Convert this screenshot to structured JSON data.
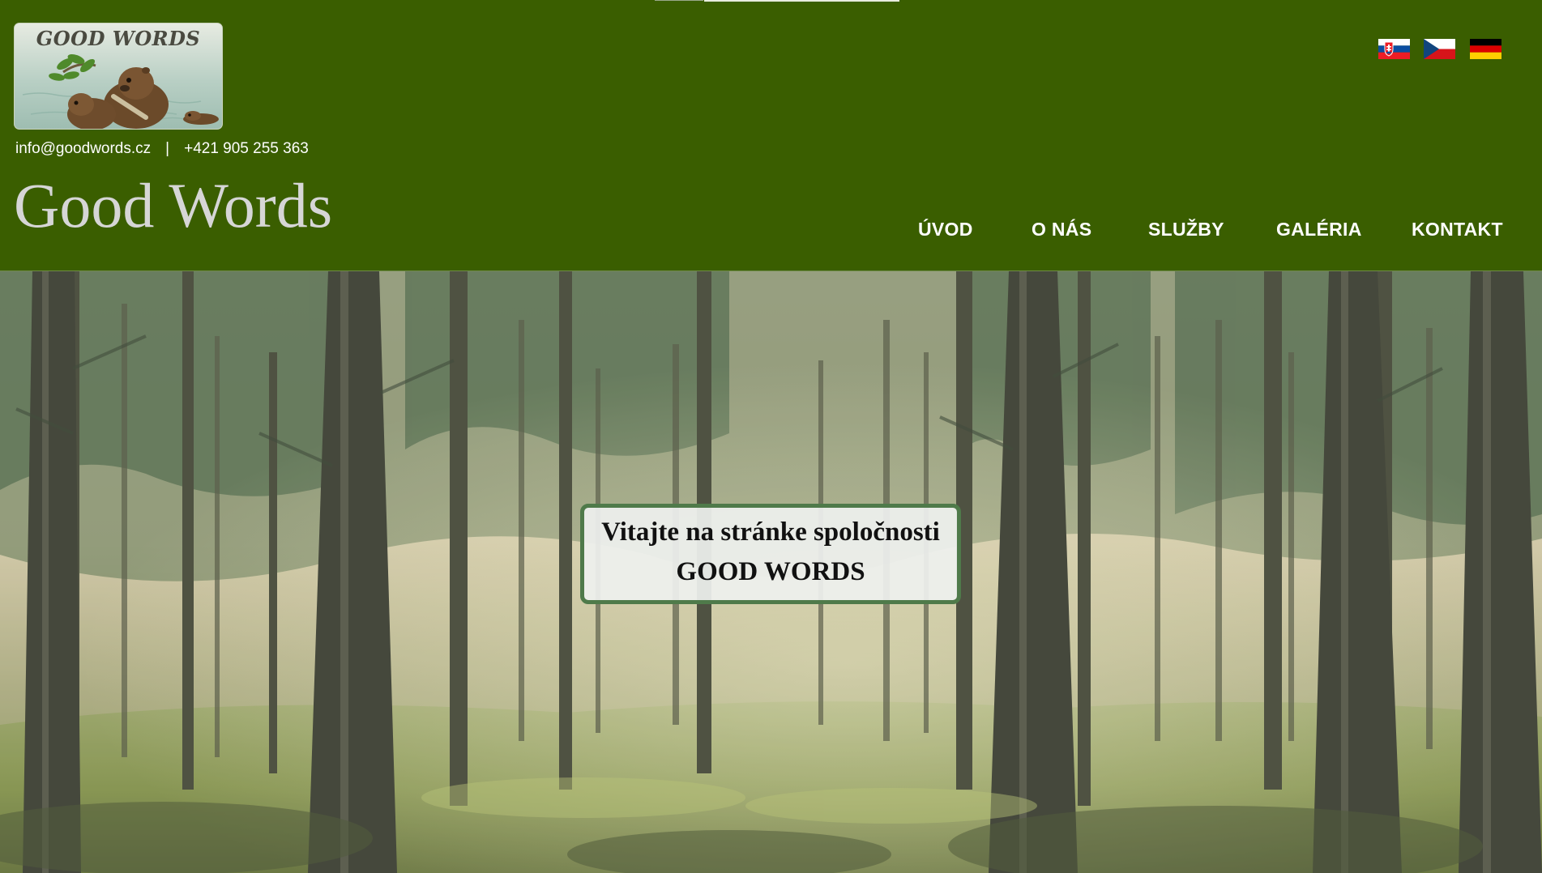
{
  "header": {
    "logo": {
      "text": "GOOD WORDS",
      "alt": "beavers-logo"
    },
    "contact": {
      "email": "info@goodwords.cz",
      "separator": "|",
      "phone": "+421 905 255 363"
    },
    "site_title": "Good Words",
    "languages": [
      {
        "code": "sk",
        "name": "slovak-flag"
      },
      {
        "code": "cz",
        "name": "czech-flag"
      },
      {
        "code": "de",
        "name": "german-flag"
      }
    ],
    "nav": [
      {
        "label": "ÚVOD"
      },
      {
        "label": "O NÁS"
      },
      {
        "label": "SLUŽBY"
      },
      {
        "label": "GALÉRIA"
      },
      {
        "label": "KONTAKT"
      }
    ]
  },
  "hero": {
    "welcome_line1": "Vitajte na stránke spoločnosti",
    "welcome_line2": "GOOD WORDS"
  },
  "colors": {
    "header_bg": "#3a5e00",
    "nav_text": "#ffffff",
    "title_text": "#d6d6d6",
    "welcome_border": "#4f7a4a"
  }
}
